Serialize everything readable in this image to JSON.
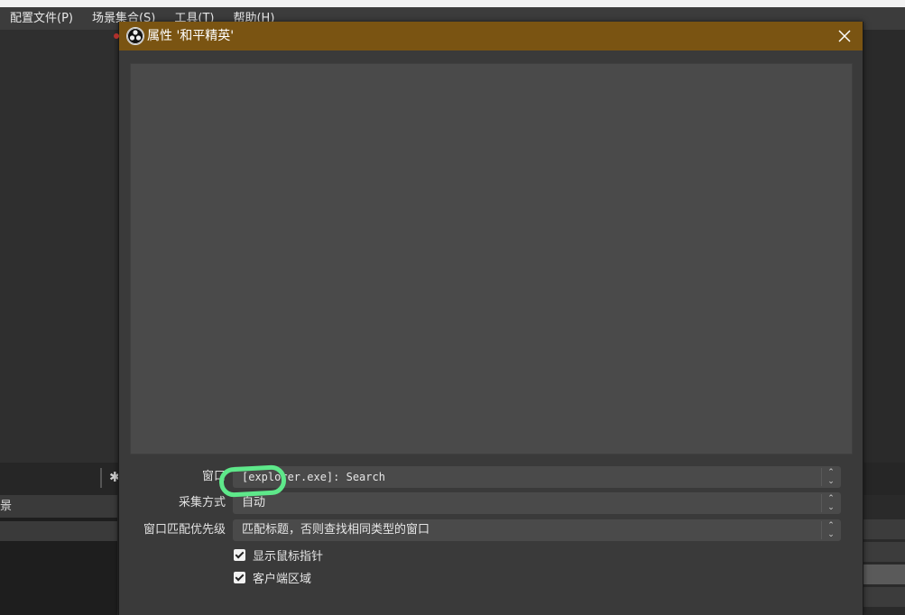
{
  "menubar": {
    "items": [
      "配置文件(P)",
      "场景集合(S)",
      "工具(T)",
      "帮助(H)"
    ]
  },
  "background": {
    "scenes_header": "景"
  },
  "dialog": {
    "title": "属性 '和平精英'",
    "fields": {
      "window": {
        "label": "窗口",
        "value": "[explorer.exe]: Search"
      },
      "capture_method": {
        "label": "采集方式",
        "value": "自动"
      },
      "window_match_priority": {
        "label": "窗口匹配优先级",
        "value": "匹配标题，否则查找相同类型的窗口"
      }
    },
    "checkboxes": {
      "show_cursor": {
        "label": "显示鼠标指针",
        "checked": true
      },
      "client_area": {
        "label": "客户端区域",
        "checked": true
      }
    }
  },
  "colors": {
    "titlebar": "#7a5412",
    "highlight": "#5ee88a"
  }
}
